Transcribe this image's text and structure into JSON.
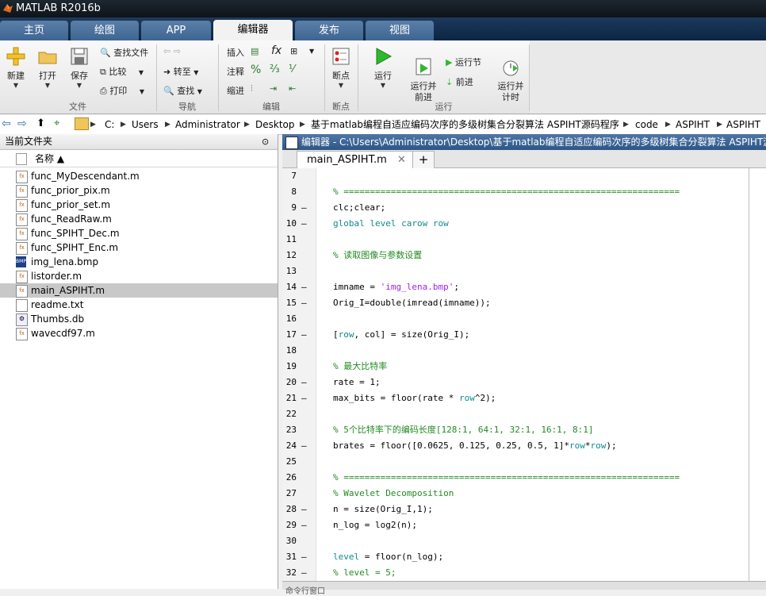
{
  "window": {
    "title": "MATLAB R2016b"
  },
  "tabs": [
    {
      "label": "主页"
    },
    {
      "label": "绘图"
    },
    {
      "label": "APP"
    },
    {
      "label": "编辑器"
    },
    {
      "label": "发布"
    },
    {
      "label": "视图"
    }
  ],
  "ribbon": {
    "new_label": "新建",
    "open_label": "打开",
    "save_label": "保存",
    "find_files_label": "查找文件",
    "compare_label": "比较",
    "print_label": "打印",
    "file_group": "文件",
    "goto_label": "转至",
    "find_label": "查找",
    "nav_group": "导航",
    "insert_label": "插入",
    "comment_label": "注释",
    "indent_label": "缩进",
    "fx_label": "fx",
    "edit_group": "编辑",
    "breakpoints_label": "断点",
    "breakpoints_group": "断点",
    "run_label": "运行",
    "run_advance_label": "运行并\n前进",
    "run_section_label": "运行节",
    "advance_label": "前进",
    "run_time_label": "运行并\n计时",
    "run_group": "运行"
  },
  "address": {
    "crumbs": [
      "C:",
      "Users",
      "Administrator",
      "Desktop",
      "基于matlab编程自适应编码次序的多级树集合分裂算法 ASPIHT源码程序",
      "code",
      "ASPIHT",
      "ASPIHT"
    ]
  },
  "current_folder": {
    "title": "当前文件夹",
    "col_name": "名称 ▲",
    "files": [
      {
        "name": "func_MyDescendant.m",
        "type": "m"
      },
      {
        "name": "func_prior_pix.m",
        "type": "m"
      },
      {
        "name": "func_prior_set.m",
        "type": "m"
      },
      {
        "name": "func_ReadRaw.m",
        "type": "m"
      },
      {
        "name": "func_SPIHT_Dec.m",
        "type": "m"
      },
      {
        "name": "func_SPIHT_Enc.m",
        "type": "m"
      },
      {
        "name": "img_lena.bmp",
        "type": "bmp"
      },
      {
        "name": "listorder.m",
        "type": "m"
      },
      {
        "name": "main_ASPIHT.m",
        "type": "m",
        "selected": true
      },
      {
        "name": "readme.txt",
        "type": "txt"
      },
      {
        "name": "Thumbs.db",
        "type": "db"
      },
      {
        "name": "wavecdf97.m",
        "type": "m"
      }
    ]
  },
  "editor": {
    "title": "编辑器 - C:\\Users\\Administrator\\Desktop\\基于matlab编程自适应编码次序的多级树集合分裂算法 ASPIHT源",
    "tab_label": "main_ASPIHT.m",
    "lines": [
      {
        "n": "7",
        "dash": "",
        "segs": []
      },
      {
        "n": "8",
        "dash": "",
        "segs": [
          {
            "c": "cmt",
            "t": "% ================================================================"
          }
        ]
      },
      {
        "n": "9",
        "dash": "–",
        "segs": [
          {
            "c": "",
            "t": "clc;clear;"
          }
        ]
      },
      {
        "n": "10",
        "dash": "–",
        "segs": [
          {
            "c": "glb",
            "t": "global level carow row"
          }
        ]
      },
      {
        "n": "11",
        "dash": "",
        "segs": []
      },
      {
        "n": "12",
        "dash": "",
        "segs": [
          {
            "c": "cmt",
            "t": "% 读取图像与参数设置"
          }
        ]
      },
      {
        "n": "13",
        "dash": "",
        "segs": []
      },
      {
        "n": "14",
        "dash": "–",
        "segs": [
          {
            "c": "",
            "t": "imname = "
          },
          {
            "c": "str",
            "t": "'img_lena.bmp'"
          },
          {
            "c": "",
            "t": ";"
          }
        ]
      },
      {
        "n": "15",
        "dash": "–",
        "segs": [
          {
            "c": "",
            "t": "Orig_I=double(imread(imname));"
          }
        ]
      },
      {
        "n": "16",
        "dash": "",
        "segs": []
      },
      {
        "n": "17",
        "dash": "–",
        "segs": [
          {
            "c": "",
            "t": "["
          },
          {
            "c": "glb",
            "t": "row"
          },
          {
            "c": "",
            "t": ", col] = size(Orig_I);"
          }
        ]
      },
      {
        "n": "18",
        "dash": "",
        "segs": []
      },
      {
        "n": "19",
        "dash": "",
        "segs": [
          {
            "c": "cmt",
            "t": "% 最大比特率"
          }
        ]
      },
      {
        "n": "20",
        "dash": "–",
        "segs": [
          {
            "c": "",
            "t": "rate = 1;"
          }
        ]
      },
      {
        "n": "21",
        "dash": "–",
        "segs": [
          {
            "c": "",
            "t": "max_bits = floor(rate * "
          },
          {
            "c": "glb",
            "t": "row"
          },
          {
            "c": "",
            "t": "^2);"
          }
        ]
      },
      {
        "n": "22",
        "dash": "",
        "segs": []
      },
      {
        "n": "23",
        "dash": "",
        "segs": [
          {
            "c": "cmt",
            "t": "% 5个比特率下的编码长度[128:1, 64:1, 32:1, 16:1, 8:1]"
          }
        ]
      },
      {
        "n": "24",
        "dash": "–",
        "segs": [
          {
            "c": "",
            "t": "brates = floor([0.0625, 0.125, 0.25, 0.5, 1]*"
          },
          {
            "c": "glb",
            "t": "row"
          },
          {
            "c": "",
            "t": "*"
          },
          {
            "c": "glb",
            "t": "row"
          },
          {
            "c": "",
            "t": ");"
          }
        ]
      },
      {
        "n": "25",
        "dash": "",
        "segs": []
      },
      {
        "n": "26",
        "dash": "",
        "segs": [
          {
            "c": "cmt",
            "t": "% ================================================================"
          }
        ]
      },
      {
        "n": "27",
        "dash": "",
        "segs": [
          {
            "c": "cmt",
            "t": "% Wavelet Decomposition"
          }
        ]
      },
      {
        "n": "28",
        "dash": "–",
        "segs": [
          {
            "c": "",
            "t": "n = size(Orig_I,1);"
          }
        ]
      },
      {
        "n": "29",
        "dash": "–",
        "segs": [
          {
            "c": "",
            "t": "n_log = log2(n);"
          }
        ]
      },
      {
        "n": "30",
        "dash": "",
        "segs": []
      },
      {
        "n": "31",
        "dash": "–",
        "segs": [
          {
            "c": "glb",
            "t": "level"
          },
          {
            "c": "",
            "t": " = floor(n_log);"
          }
        ]
      },
      {
        "n": "32",
        "dash": "–",
        "segs": [
          {
            "c": "cmt",
            "t": "% level = 5;"
          }
        ]
      }
    ]
  },
  "command_window_hint": "命令行窗口"
}
